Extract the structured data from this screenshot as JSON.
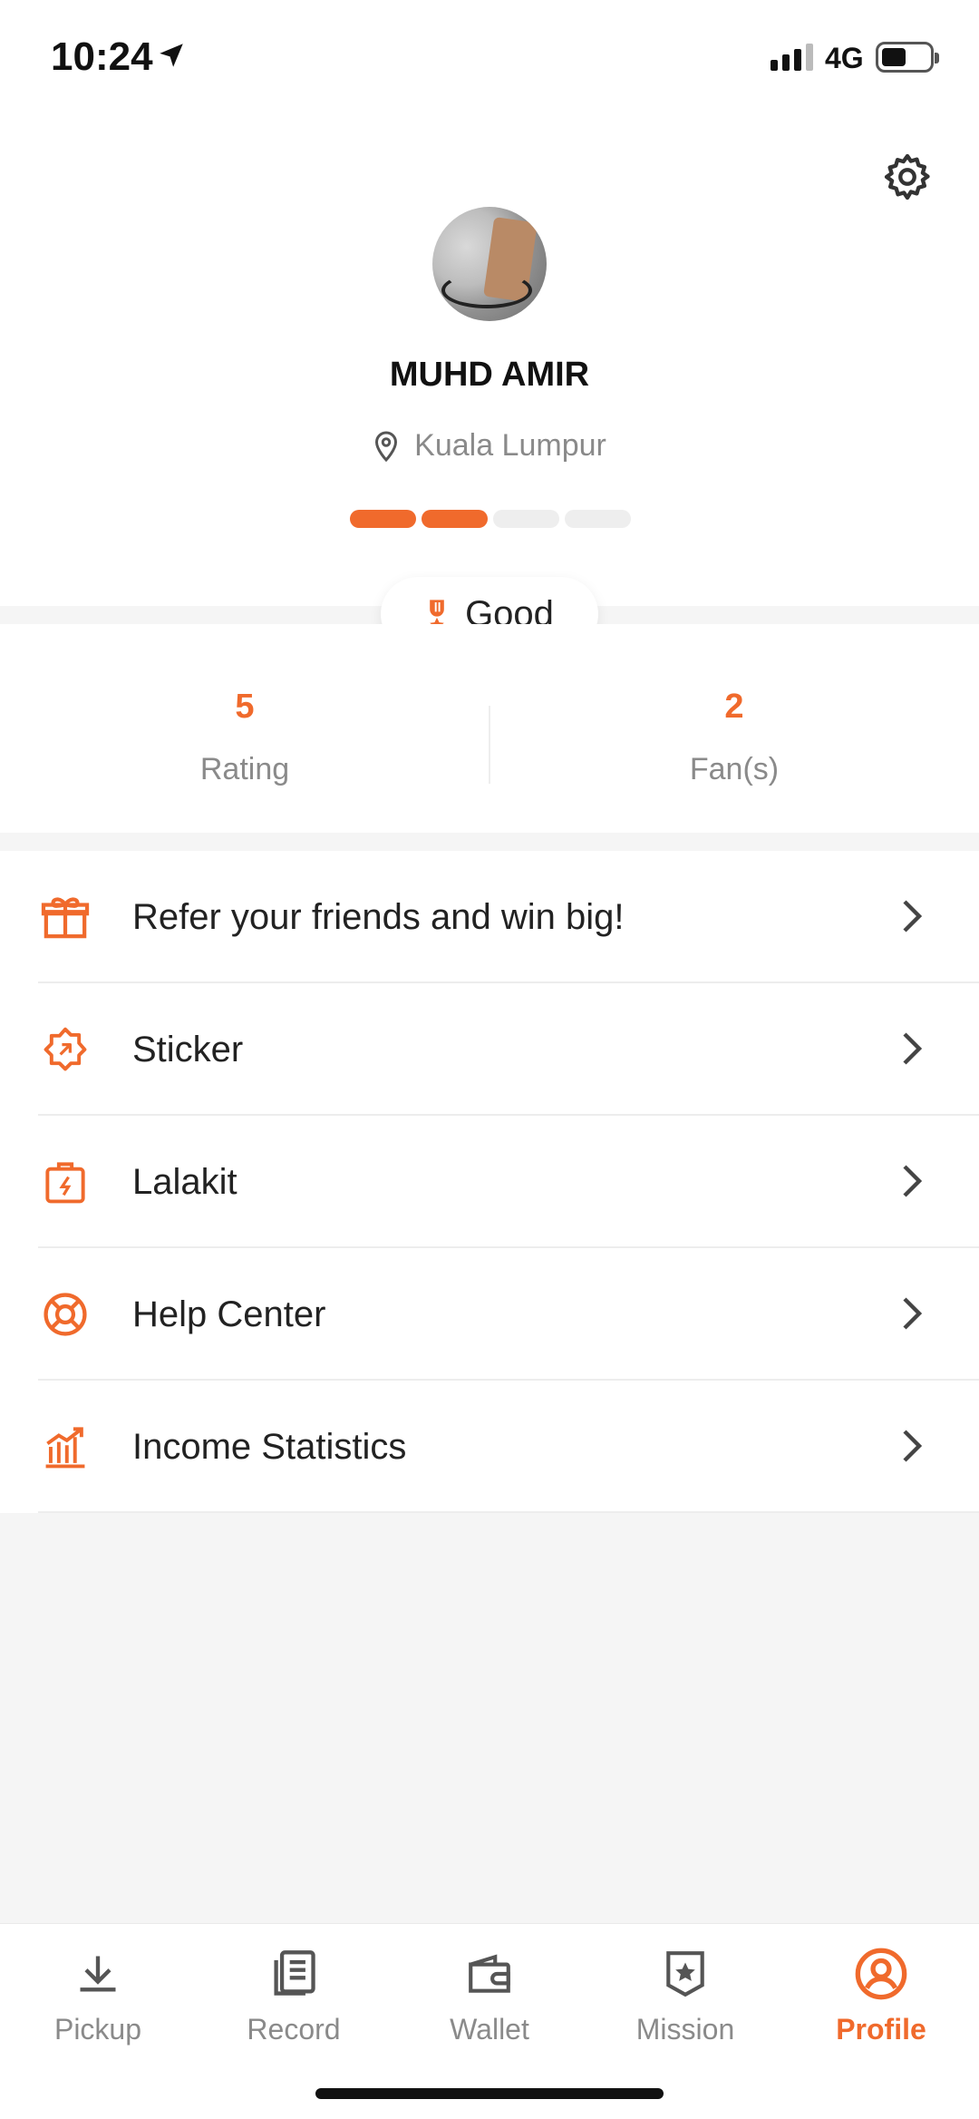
{
  "status_bar": {
    "time": "10:24",
    "network": "4G",
    "location_icon": "location-arrow-icon",
    "battery_level": 0.5
  },
  "header": {
    "settings_icon": "gear-icon"
  },
  "profile": {
    "name": "MUHD AMIR",
    "location": "Kuala Lumpur",
    "level_progress": {
      "filled": 2,
      "total": 4
    },
    "badge": {
      "label": "Good",
      "icon": "trophy-icon"
    }
  },
  "stats": [
    {
      "value": "5",
      "label": "Rating"
    },
    {
      "value": "2",
      "label": "Fan(s)"
    }
  ],
  "menu": [
    {
      "label": "Refer your friends and win big!",
      "icon": "gift-icon"
    },
    {
      "label": "Sticker",
      "icon": "sticker-icon"
    },
    {
      "label": "Lalakit",
      "icon": "lalakit-bag-icon"
    },
    {
      "label": "Help Center",
      "icon": "lifebuoy-icon"
    },
    {
      "label": "Income Statistics",
      "icon": "bar-chart-icon"
    }
  ],
  "tabs": [
    {
      "label": "Pickup",
      "icon": "download-icon"
    },
    {
      "label": "Record",
      "icon": "document-icon"
    },
    {
      "label": "Wallet",
      "icon": "wallet-icon"
    },
    {
      "label": "Mission",
      "icon": "star-shield-icon"
    },
    {
      "label": "Profile",
      "icon": "profile-icon",
      "active": true
    }
  ],
  "colors": {
    "accent": "#f06a2c",
    "muted": "#8a8a8a",
    "background": "#f5f5f5"
  }
}
